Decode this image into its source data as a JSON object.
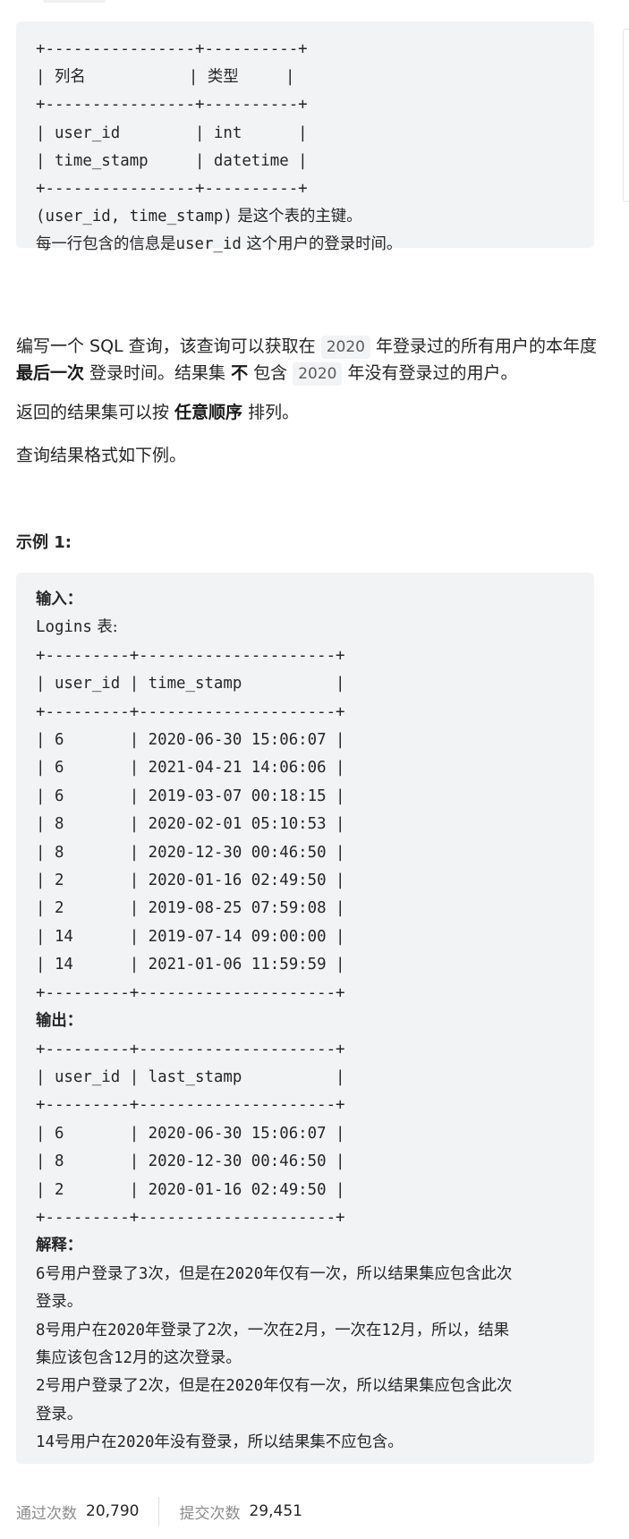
{
  "schema_block": {
    "table_lines": [
      "+----------------+----------+",
      "| 列名           | 类型     |",
      "+----------------+----------+",
      "| user_id        | int      |",
      "| time_stamp     | datetime |",
      "+----------------+----------+"
    ],
    "key_code": "(user_id, time_stamp)",
    "key_text": " 是这个表的主键。",
    "desc_prefix": "每一行包含的信息是",
    "desc_code": "user_id",
    "desc_suffix": " 这个用户的登录时间。"
  },
  "description": {
    "p1_a": "编写一个 SQL 查询，该查询可以获取在 ",
    "p1_year1": "2020",
    "p1_b": " 年登录过的所有用户的本年度 ",
    "p1_bold1": "最后一次",
    "p1_c": " 登录时间。结果集 ",
    "p1_bold2": "不",
    "p1_d": " 包含 ",
    "p1_year2": "2020",
    "p1_e": " 年没有登录过的用户。",
    "p2_a": "返回的结果集可以按 ",
    "p2_bold": "任意顺序",
    "p2_b": " 排列。",
    "p3": "查询结果格式如下例。"
  },
  "example": {
    "title": "示例 1:",
    "input_label": "输入：",
    "input_table_name": "Logins",
    "input_table_suffix": " 表:",
    "input_lines": [
      "+---------+---------------------+",
      "| user_id | time_stamp          |",
      "+---------+---------------------+",
      "| 6       | 2020-06-30 15:06:07 |",
      "| 6       | 2021-04-21 14:06:06 |",
      "| 6       | 2019-03-07 00:18:15 |",
      "| 8       | 2020-02-01 05:10:53 |",
      "| 8       | 2020-12-30 00:46:50 |",
      "| 2       | 2020-01-16 02:49:50 |",
      "| 2       | 2019-08-25 07:59:08 |",
      "| 14      | 2019-07-14 09:00:00 |",
      "| 14      | 2021-01-06 11:59:59 |",
      "+---------+---------------------+"
    ],
    "output_label": "输出：",
    "output_lines": [
      "+---------+---------------------+",
      "| user_id | last_stamp          |",
      "+---------+---------------------+",
      "| 6       | 2020-06-30 15:06:07 |",
      "| 8       | 2020-12-30 00:46:50 |",
      "| 2       | 2020-01-16 02:49:50 |",
      "+---------+---------------------+"
    ],
    "explain_label": "解释：",
    "explanations": [
      [
        "6",
        "号用户登录了",
        "3",
        "次，但是在",
        "2020",
        "年仅有一次，所以结果集应包含此次"
      ],
      [
        "登录。"
      ],
      [
        "8",
        "号用户在",
        "2020",
        "年登录了",
        "2",
        "次，一次在",
        "2",
        "月，一次在",
        "12",
        "月，所以，结果"
      ],
      [
        "集应该包含",
        "12",
        "月的这次登录。"
      ],
      [
        "2",
        "号用户登录了",
        "2",
        "次，但是在",
        "2020",
        "年仅有一次，所以结果集应包含此次"
      ],
      [
        "登录。"
      ],
      [
        "14",
        "号用户在",
        "2020",
        "年没有登录，所以结果集不应包含。"
      ]
    ]
  },
  "footer": {
    "accepted_label": "通过次数",
    "accepted_value": "20,790",
    "submitted_label": "提交次数",
    "submitted_value": "29,451"
  }
}
